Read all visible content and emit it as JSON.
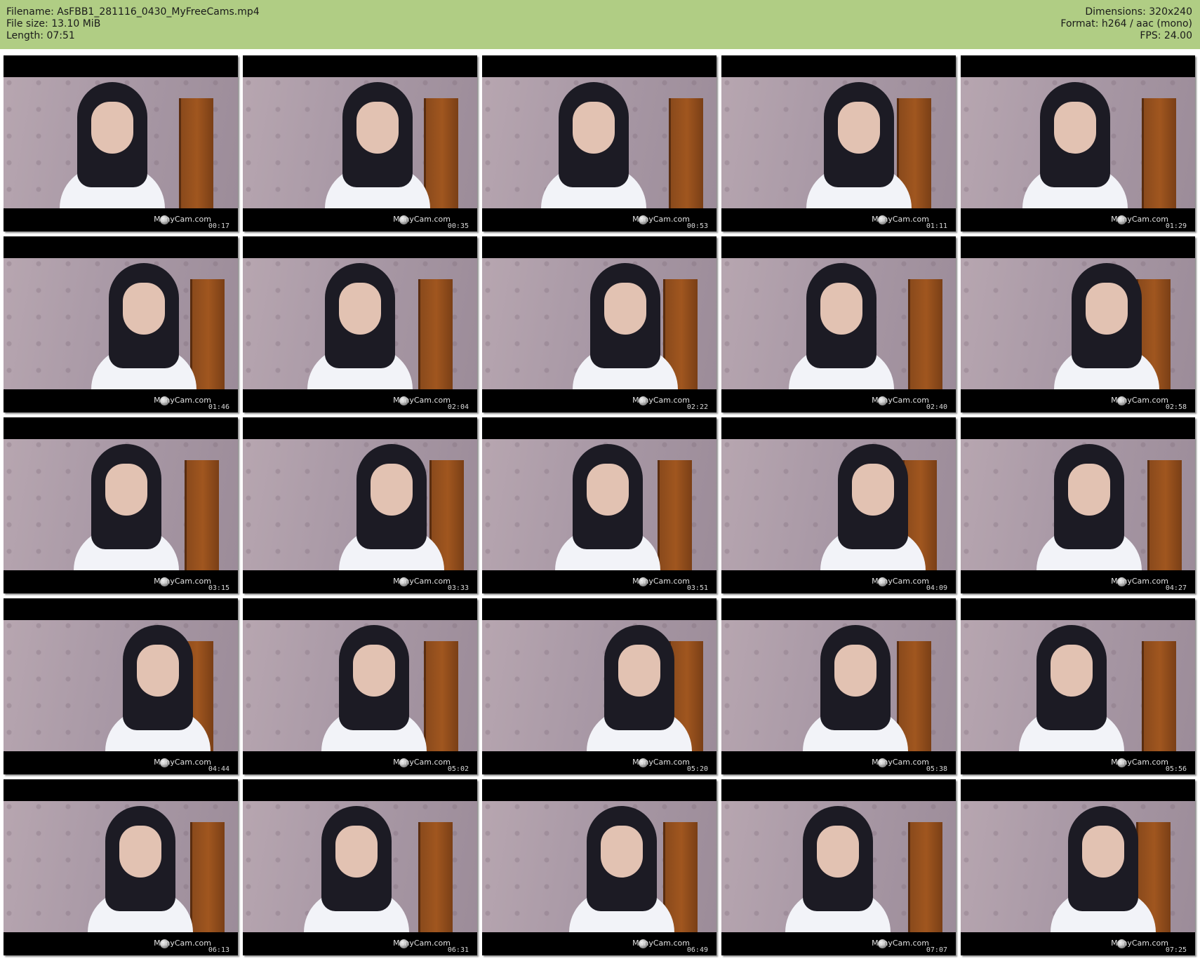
{
  "header": {
    "filename": "Filename: AsFBB1_281116_0430_MyFreeCams.mp4",
    "filesize": "File size: 13.10 MiB",
    "length": "Length: 07:51",
    "dimensions": "Dimensions: 320x240",
    "format": "Format: h264 / aac (mono)",
    "fps": "FPS: 24.00"
  },
  "watermark_bottom": "ManyCam.com",
  "colors": {
    "header_background": "#b0cd84",
    "thumb_border": "#000000"
  },
  "thumbnails": [
    {
      "timestamp": "00:17"
    },
    {
      "timestamp": "00:35"
    },
    {
      "timestamp": "00:53"
    },
    {
      "timestamp": "01:11"
    },
    {
      "timestamp": "01:29"
    },
    {
      "timestamp": "01:46"
    },
    {
      "timestamp": "02:04"
    },
    {
      "timestamp": "02:22"
    },
    {
      "timestamp": "02:40"
    },
    {
      "timestamp": "02:58"
    },
    {
      "timestamp": "03:15"
    },
    {
      "timestamp": "03:33"
    },
    {
      "timestamp": "03:51"
    },
    {
      "timestamp": "04:09"
    },
    {
      "timestamp": "04:27"
    },
    {
      "timestamp": "04:44"
    },
    {
      "timestamp": "05:02"
    },
    {
      "timestamp": "05:20"
    },
    {
      "timestamp": "05:38"
    },
    {
      "timestamp": "05:56"
    },
    {
      "timestamp": "06:13"
    },
    {
      "timestamp": "06:31"
    },
    {
      "timestamp": "06:49"
    },
    {
      "timestamp": "07:07"
    },
    {
      "timestamp": "07:25"
    }
  ]
}
